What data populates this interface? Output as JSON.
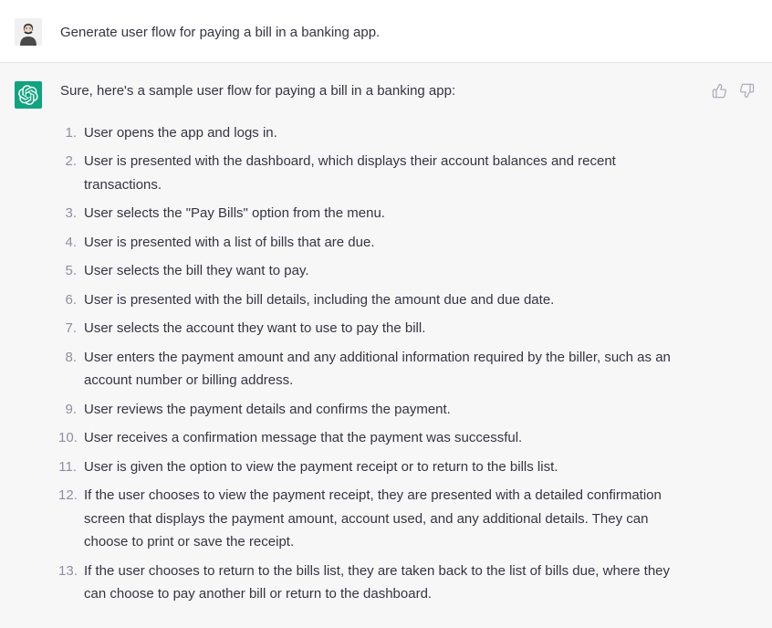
{
  "user": {
    "prompt": "Generate user flow for paying a bill in a banking app."
  },
  "assistant": {
    "intro": "Sure, here's a sample user flow for paying a bill in a banking app:",
    "steps": [
      "User opens the app and logs in.",
      "User is presented with the dashboard, which displays their account balances and recent transactions.",
      "User selects the \"Pay Bills\" option from the menu.",
      "User is presented with a list of bills that are due.",
      "User selects the bill they want to pay.",
      "User is presented with the bill details, including the amount due and due date.",
      "User selects the account they want to use to pay the bill.",
      "User enters the payment amount and any additional information required by the biller, such as an account number or billing address.",
      "User reviews the payment details and confirms the payment.",
      "User receives a confirmation message that the payment was successful.",
      "User is given the option to view the payment receipt or to return to the bills list.",
      "If the user chooses to view the payment receipt, they are presented with a detailed confirmation screen that displays the payment amount, account used, and any additional details. They can choose to print or save the receipt.",
      "If the user chooses to return to the bills list, they are taken back to the list of bills due, where they can choose to pay another bill or return to the dashboard."
    ]
  }
}
